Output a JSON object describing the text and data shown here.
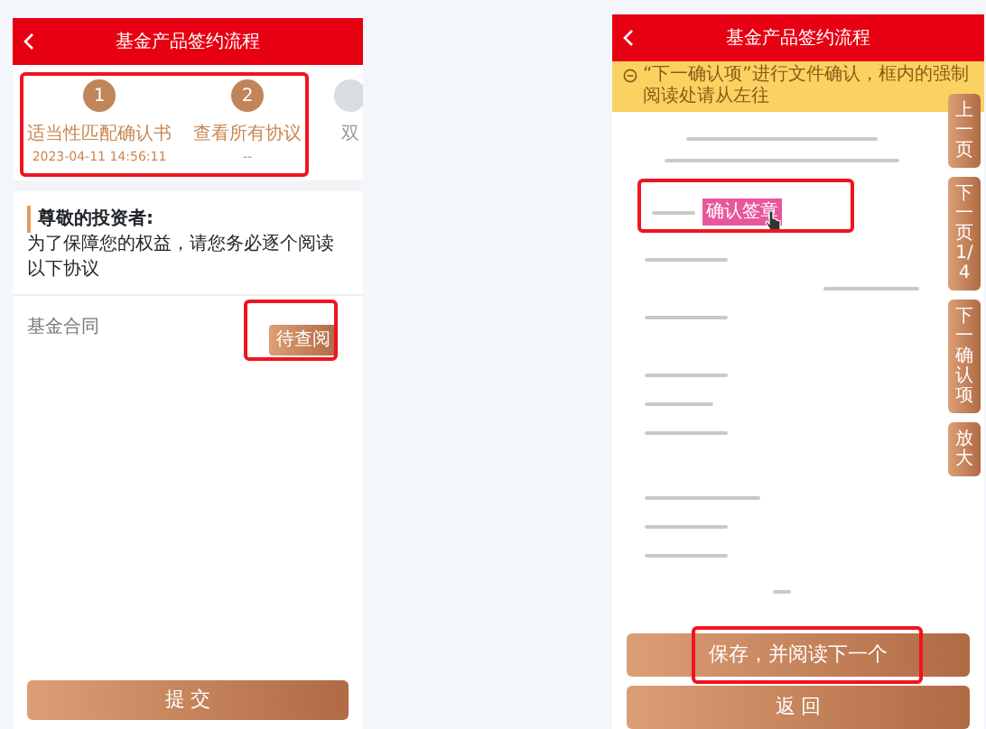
{
  "left_screen": {
    "header": {
      "title": "基金产品签约流程"
    },
    "steps_highlighted": true,
    "steps": [
      {
        "number": "1",
        "label": "适当性匹配确认书",
        "detail": "2023-04-11 14:56:11",
        "active": true
      },
      {
        "number": "2",
        "label": "查看所有协议",
        "detail": "--",
        "active": true
      },
      {
        "label": "双",
        "active": false
      }
    ],
    "greeting": {
      "title": "尊敬的投资者:",
      "message": "为了保障您的权益，请您务必逐个阅读以下协议"
    },
    "documents": [
      {
        "name": "基金合同",
        "action": "待查阅",
        "highlighted": true
      }
    ],
    "submit": "提 交"
  },
  "right_screen": {
    "header": {
      "title": "基金产品签约流程"
    },
    "banner": "“下一确认项”进行文件确认，框内的强制阅读处请从左往",
    "signature": {
      "button": "确认签章",
      "highlighted": true
    },
    "side_tabs": [
      "上一页",
      "下一页1/4",
      "下一确认项",
      "放大"
    ],
    "buttons": [
      {
        "label": "保存，并阅读下一个",
        "highlighted": true
      },
      {
        "label": "返 回",
        "highlighted": false
      }
    ]
  }
}
